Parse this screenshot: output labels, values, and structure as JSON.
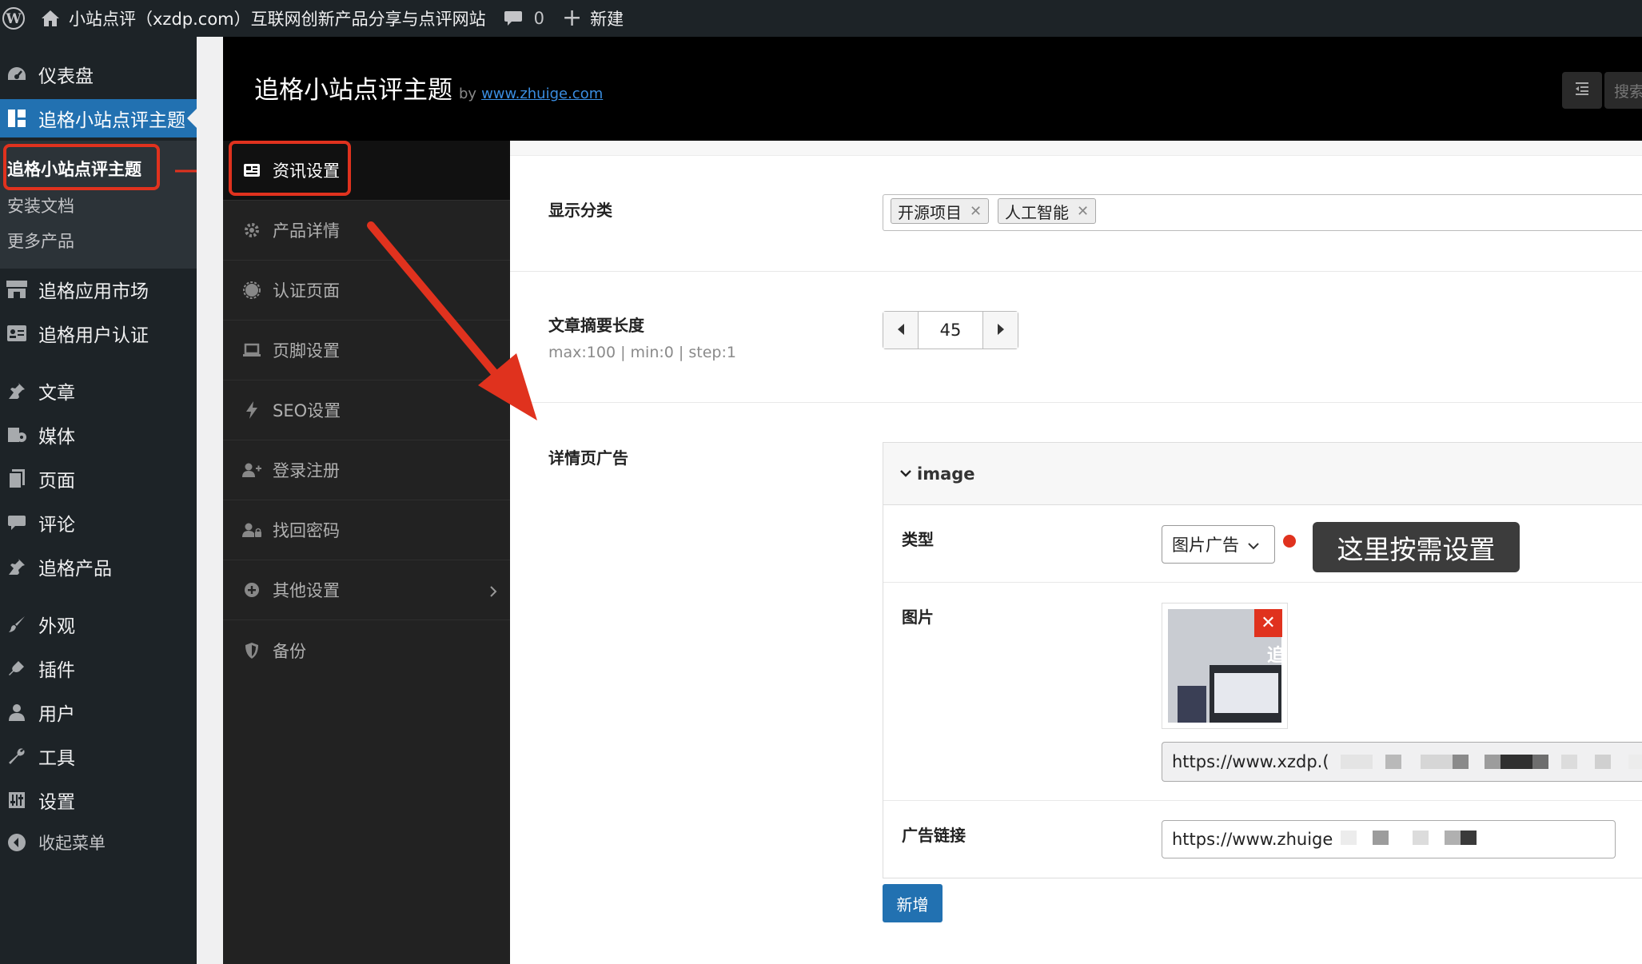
{
  "admin_bar": {
    "site_title": "小站点评（xzdp.com）互联网创新产品分享与点评网站",
    "comment_count": "0",
    "new_label": "新建"
  },
  "admin_menu": {
    "dashboard": "仪表盘",
    "theme": "追格小站点评主题",
    "submenu": [
      "追格小站点评主题",
      "安装文档",
      "更多产品"
    ],
    "app_market": "追格应用市场",
    "user_auth": "追格用户认证",
    "posts": "文章",
    "media": "媒体",
    "pages": "页面",
    "comments": "评论",
    "products": "追格产品",
    "appearance": "外观",
    "plugins": "插件",
    "users": "用户",
    "tools": "工具",
    "settings": "设置",
    "collapse": "收起菜单"
  },
  "header": {
    "title": "追格小站点评主题",
    "by": "by",
    "link": "www.zhuige.com",
    "search_label": "搜索"
  },
  "options_nav": [
    {
      "label": "资讯设置",
      "icon": "newspaper-icon"
    },
    {
      "label": "产品详情",
      "icon": "gear-icon"
    },
    {
      "label": "认证页面",
      "icon": "badge-icon"
    },
    {
      "label": "页脚设置",
      "icon": "laptop-icon"
    },
    {
      "label": "SEO设置",
      "icon": "bolt-icon"
    },
    {
      "label": "登录注册",
      "icon": "user-plus-icon"
    },
    {
      "label": "找回密码",
      "icon": "user-lock-icon"
    },
    {
      "label": "其他设置",
      "icon": "plus-circle-icon"
    },
    {
      "label": "备份",
      "icon": "shield-icon"
    }
  ],
  "fields": {
    "category": {
      "label": "显示分类",
      "tags": [
        "开源项目",
        "人工智能"
      ]
    },
    "excerpt": {
      "label": "文章摘要长度",
      "hint": "max:100 | min:0 | step:1",
      "value": "45"
    },
    "detail_ad": {
      "label": "详情页广告",
      "group_title": "image",
      "type_label": "类型",
      "type_value": "图片广告",
      "tooltip": "这里按需设置",
      "image_label": "图片",
      "image_url": "https://www.xzdp.(",
      "link_label": "广告链接",
      "link_url": "https://www.zhuige",
      "add_button": "新增"
    }
  },
  "colors": {
    "accent": "#2271b1",
    "annotation_red": "#e0321e",
    "admin_bg": "#1d2327"
  }
}
